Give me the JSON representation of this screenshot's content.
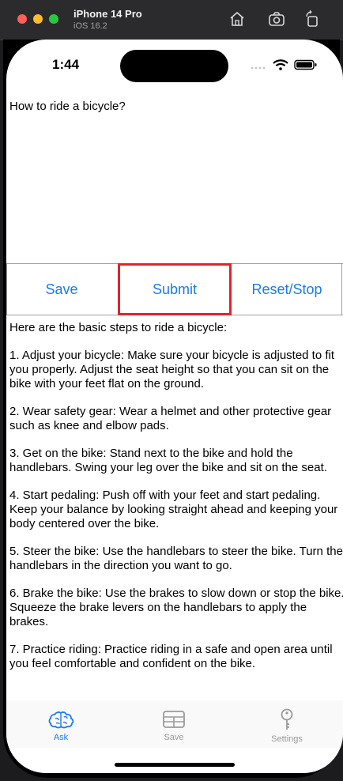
{
  "simulator": {
    "device": "iPhone 14 Pro",
    "os": "iOS 16.2",
    "icons": [
      "home-icon",
      "screenshot-icon",
      "rotate-icon"
    ]
  },
  "status_bar": {
    "time": "1:44",
    "icons": [
      "cellular-icon",
      "wifi-icon",
      "battery-icon"
    ]
  },
  "prompt": {
    "text": "How to ride a bicycle?"
  },
  "buttons": {
    "save": "Save",
    "submit": "Submit",
    "reset": "Reset/Stop"
  },
  "colors": {
    "accent": "#1a7cf2",
    "highlight": "#e8202a",
    "inactive_tab": "#9a9a9a"
  },
  "response": {
    "paragraphs": [
      "Here are the basic steps to ride a bicycle:",
      "1. Adjust your bicycle: Make sure your bicycle is adjusted to fit you properly. Adjust the seat height so that you can sit on the bike with your feet flat on the ground.",
      "2. Wear safety gear: Wear a helmet and other protective gear such as knee and elbow pads.",
      "3. Get on the bike: Stand next to the bike and hold the handlebars. Swing your leg over the bike and sit on the seat.",
      "4. Start pedaling: Push off with your feet and start pedaling. Keep your balance by looking straight ahead and keeping your body centered over the bike.",
      "5. Steer the bike: Use the handlebars to steer the bike. Turn the handlebars in the direction you want to go.",
      "6. Brake the bike: Use the brakes to slow down or stop the bike. Squeeze the brake levers on the handlebars to apply the brakes.",
      "7. Practice riding: Practice riding in a safe and open area until you feel comfortable and confident on the bike."
    ]
  },
  "tabbar": {
    "tabs": [
      {
        "label": "Ask",
        "icon": "brain-icon",
        "active": true
      },
      {
        "label": "Save",
        "icon": "table-icon",
        "active": false
      },
      {
        "label": "Settings",
        "icon": "key-icon",
        "active": false
      }
    ]
  }
}
